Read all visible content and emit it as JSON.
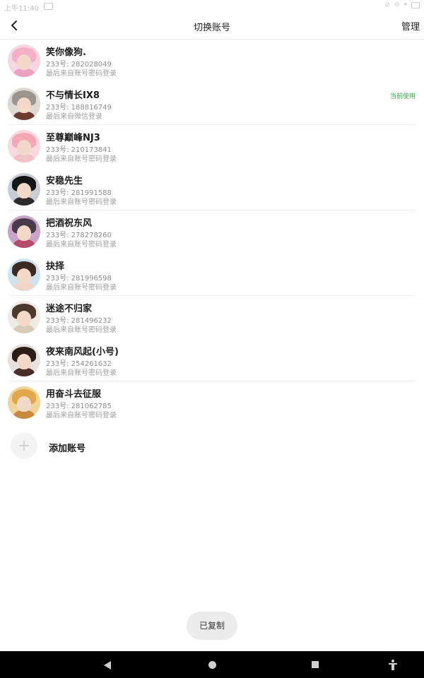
{
  "status_bar": {
    "time": "上午11:40"
  },
  "header": {
    "title": "切换账号",
    "manage_label": "管理"
  },
  "accounts": [
    {
      "name": "笑你像狗.",
      "id_line": "233号: 282028049",
      "login_line": "最后来自账号密码登录",
      "current": false,
      "avatar": {
        "bg": "#f6d6e3",
        "hair": "#f5b0c8",
        "body": "#e9a3c0"
      }
    },
    {
      "name": "不与情长IX8",
      "id_line": "233号: 188816749",
      "login_line": "最后来自微信登录",
      "current": true,
      "avatar": {
        "bg": "#dcd8d2",
        "hair": "#9b958d",
        "body": "#6b3b2e"
      }
    },
    {
      "name": "至尊巅峰NJ3",
      "id_line": "233号: 210173841",
      "login_line": "最后来自账号密码登录",
      "current": false,
      "avatar": {
        "bg": "#f7d9de",
        "hair": "#f4a8b6",
        "body": "#f0c1c8"
      }
    },
    {
      "name": "安稳先生",
      "id_line": "233号: 281991588",
      "login_line": "最后来自账号密码登录",
      "current": false,
      "avatar": {
        "bg": "#c8cdd3",
        "hair": "#151515",
        "body": "#2a2a2a"
      }
    },
    {
      "name": "把酒祝东风",
      "id_line": "233号: 278278260",
      "login_line": "最后来自账号密码登录",
      "current": false,
      "avatar": {
        "bg": "#c9a4c8",
        "hair": "#4a3a4e",
        "body": "#b64a6a"
      }
    },
    {
      "name": "抉择",
      "id_line": "233号: 281996598",
      "login_line": "最后来自账号密码登录",
      "current": false,
      "avatar": {
        "bg": "#cfe3ef",
        "hair": "#3b2a24",
        "body": "#eed6c9"
      }
    },
    {
      "name": "迷途不归家",
      "id_line": "233号: 281496232",
      "login_line": "最后来自账号密码登录",
      "current": false,
      "avatar": {
        "bg": "#efeae2",
        "hair": "#4b3a2d",
        "body": "#d8cbb8"
      }
    },
    {
      "name": "夜来南风起(小号)",
      "id_line": "233号: 254261632",
      "login_line": "最后来自账号密码登录",
      "current": false,
      "avatar": {
        "bg": "#e7e2dd",
        "hair": "#2a1d18",
        "body": "#4a2d25"
      }
    },
    {
      "name": "用奋斗去征服",
      "id_line": "233号: 281062785",
      "login_line": "最后来自账号密码登录",
      "current": false,
      "avatar": {
        "bg": "#f0d59a",
        "hair": "#e0a84a",
        "body": "#c98a3e"
      }
    }
  ],
  "current_badge": "当前使用",
  "add_account": {
    "label": "添加账号",
    "icon_glyph": "+"
  },
  "toast": {
    "text": "已复制"
  },
  "icons": {
    "back": "back-arrow-icon",
    "add": "plus-icon",
    "nav_back": "triangle-back-icon",
    "nav_home": "circle-home-icon",
    "nav_recent": "square-recent-icon",
    "nav_accessibility": "accessibility-icon"
  },
  "colors": {
    "accent_green": "#3aa449",
    "divider": "#ececec"
  }
}
